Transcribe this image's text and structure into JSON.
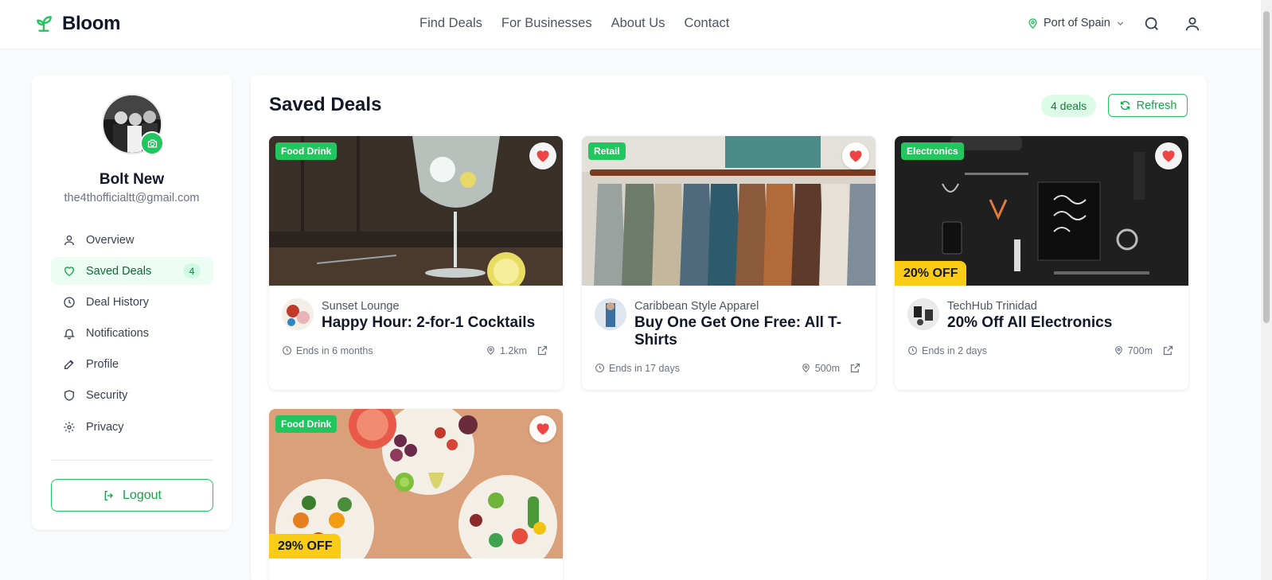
{
  "brand": {
    "name": "Bloom",
    "accent": "#22c55e"
  },
  "nav": {
    "links": [
      "Find Deals",
      "For Businesses",
      "About Us",
      "Contact"
    ],
    "location": "Port of Spain"
  },
  "user": {
    "name": "Bolt New",
    "email": "the4thofficialtt@gmail.com"
  },
  "sidebar": {
    "items": [
      {
        "label": "Overview",
        "icon": "user-icon"
      },
      {
        "label": "Saved Deals",
        "icon": "heart-icon",
        "badge": "4",
        "active": true
      },
      {
        "label": "Deal History",
        "icon": "clock-icon"
      },
      {
        "label": "Notifications",
        "icon": "bell-icon"
      },
      {
        "label": "Profile",
        "icon": "pencil-icon"
      },
      {
        "label": "Security",
        "icon": "shield-icon"
      },
      {
        "label": "Privacy",
        "icon": "gear-icon"
      }
    ],
    "logout_label": "Logout"
  },
  "main": {
    "title": "Saved Deals",
    "count_label": "4 deals",
    "refresh_label": "Refresh"
  },
  "deals": [
    {
      "category": "Food Drink",
      "business": "Sunset Lounge",
      "title": "Happy Hour: 2-for-1 Cocktails",
      "ends": "Ends in 6 months",
      "distance": "1.2km",
      "discount": ""
    },
    {
      "category": "Retail",
      "business": "Caribbean Style Apparel",
      "title": "Buy One Get One Free: All T-Shirts",
      "ends": "Ends in 17 days",
      "distance": "500m",
      "discount": ""
    },
    {
      "category": "Electronics",
      "business": "TechHub Trinidad",
      "title": "20% Off All Electronics",
      "ends": "Ends in 2 days",
      "distance": "700m",
      "discount": "20% OFF"
    },
    {
      "category": "Food Drink",
      "business": "",
      "title": "",
      "ends": "",
      "distance": "",
      "discount": "29% OFF"
    }
  ]
}
